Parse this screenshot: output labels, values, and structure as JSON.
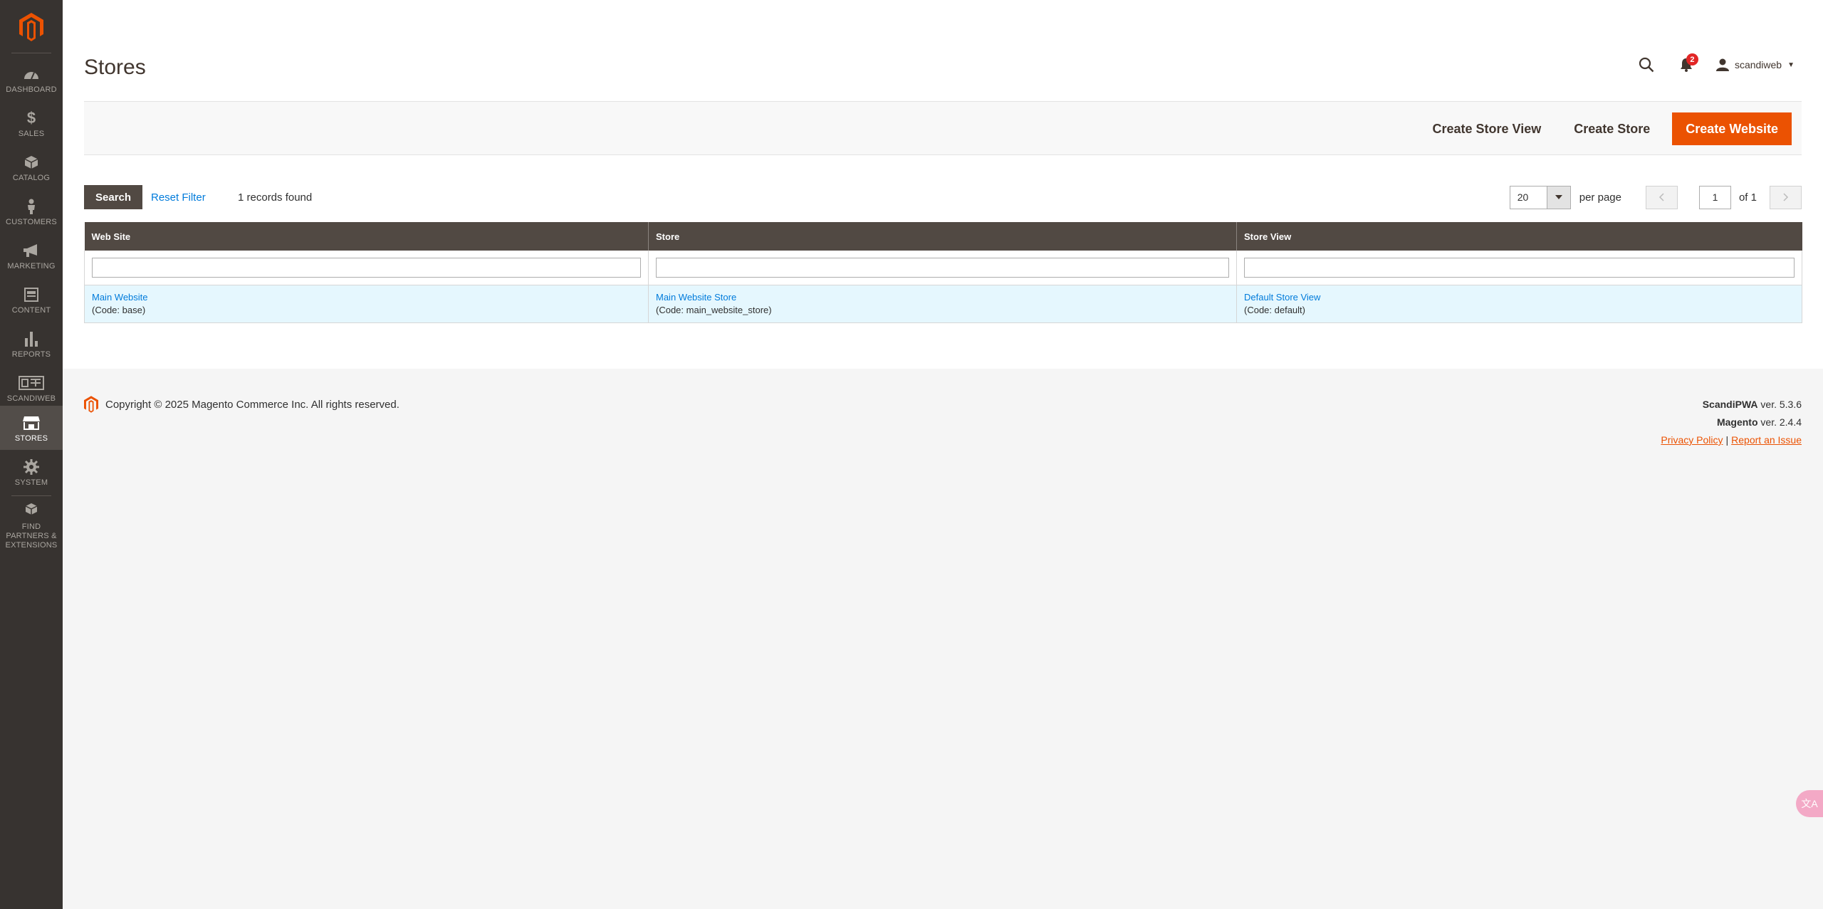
{
  "sidebar": {
    "items": [
      {
        "label": "Dashboard",
        "icon": "dashboard-icon"
      },
      {
        "label": "Sales",
        "icon": "dollar-icon"
      },
      {
        "label": "Catalog",
        "icon": "cube-icon"
      },
      {
        "label": "Customers",
        "icon": "person-icon"
      },
      {
        "label": "Marketing",
        "icon": "megaphone-icon"
      },
      {
        "label": "Content",
        "icon": "layout-icon"
      },
      {
        "label": "Reports",
        "icon": "bar-chart-icon"
      },
      {
        "label": "ScandiWeb",
        "icon": "scandiweb-icon"
      },
      {
        "label": "Stores",
        "icon": "storefront-icon"
      },
      {
        "label": "System",
        "icon": "gear-icon"
      },
      {
        "label": "Find Partners & Extensions",
        "icon": "boxes-icon"
      }
    ],
    "active": "Stores"
  },
  "header": {
    "title": "Stores",
    "notifications_count": "2",
    "username": "scandiweb"
  },
  "actions": {
    "create_store_view": "Create Store View",
    "create_store": "Create Store",
    "create_website": "Create Website"
  },
  "toolbar": {
    "search_label": "Search",
    "reset_label": "Reset Filter",
    "records_text": "1 records found",
    "per_page_value": "20",
    "per_page_label": "per page",
    "page_value": "1",
    "page_of": "of 1"
  },
  "grid": {
    "columns": [
      "Web Site",
      "Store",
      "Store View"
    ],
    "rows": [
      {
        "website": "Main Website",
        "website_code": "(Code: base)",
        "store": "Main Website Store",
        "store_code": "(Code: main_website_store)",
        "store_view": "Default Store View",
        "store_view_code": "(Code: default)"
      }
    ]
  },
  "footer": {
    "copyright": "Copyright © 2025 Magento Commerce Inc. All rights reserved.",
    "scandipwa_name": "ScandiPWA",
    "scandipwa_version": "ver. 5.3.6",
    "magento_name": "Magento",
    "magento_version": "ver. 2.4.4",
    "privacy_policy": "Privacy Policy",
    "separator": "|",
    "report_issue": "Report an Issue"
  },
  "colors": {
    "sidebar_bg": "#373330",
    "accent": "#eb5202",
    "link": "#007bdb",
    "grid_header": "#514943",
    "row_highlight": "#e5f7fe"
  }
}
